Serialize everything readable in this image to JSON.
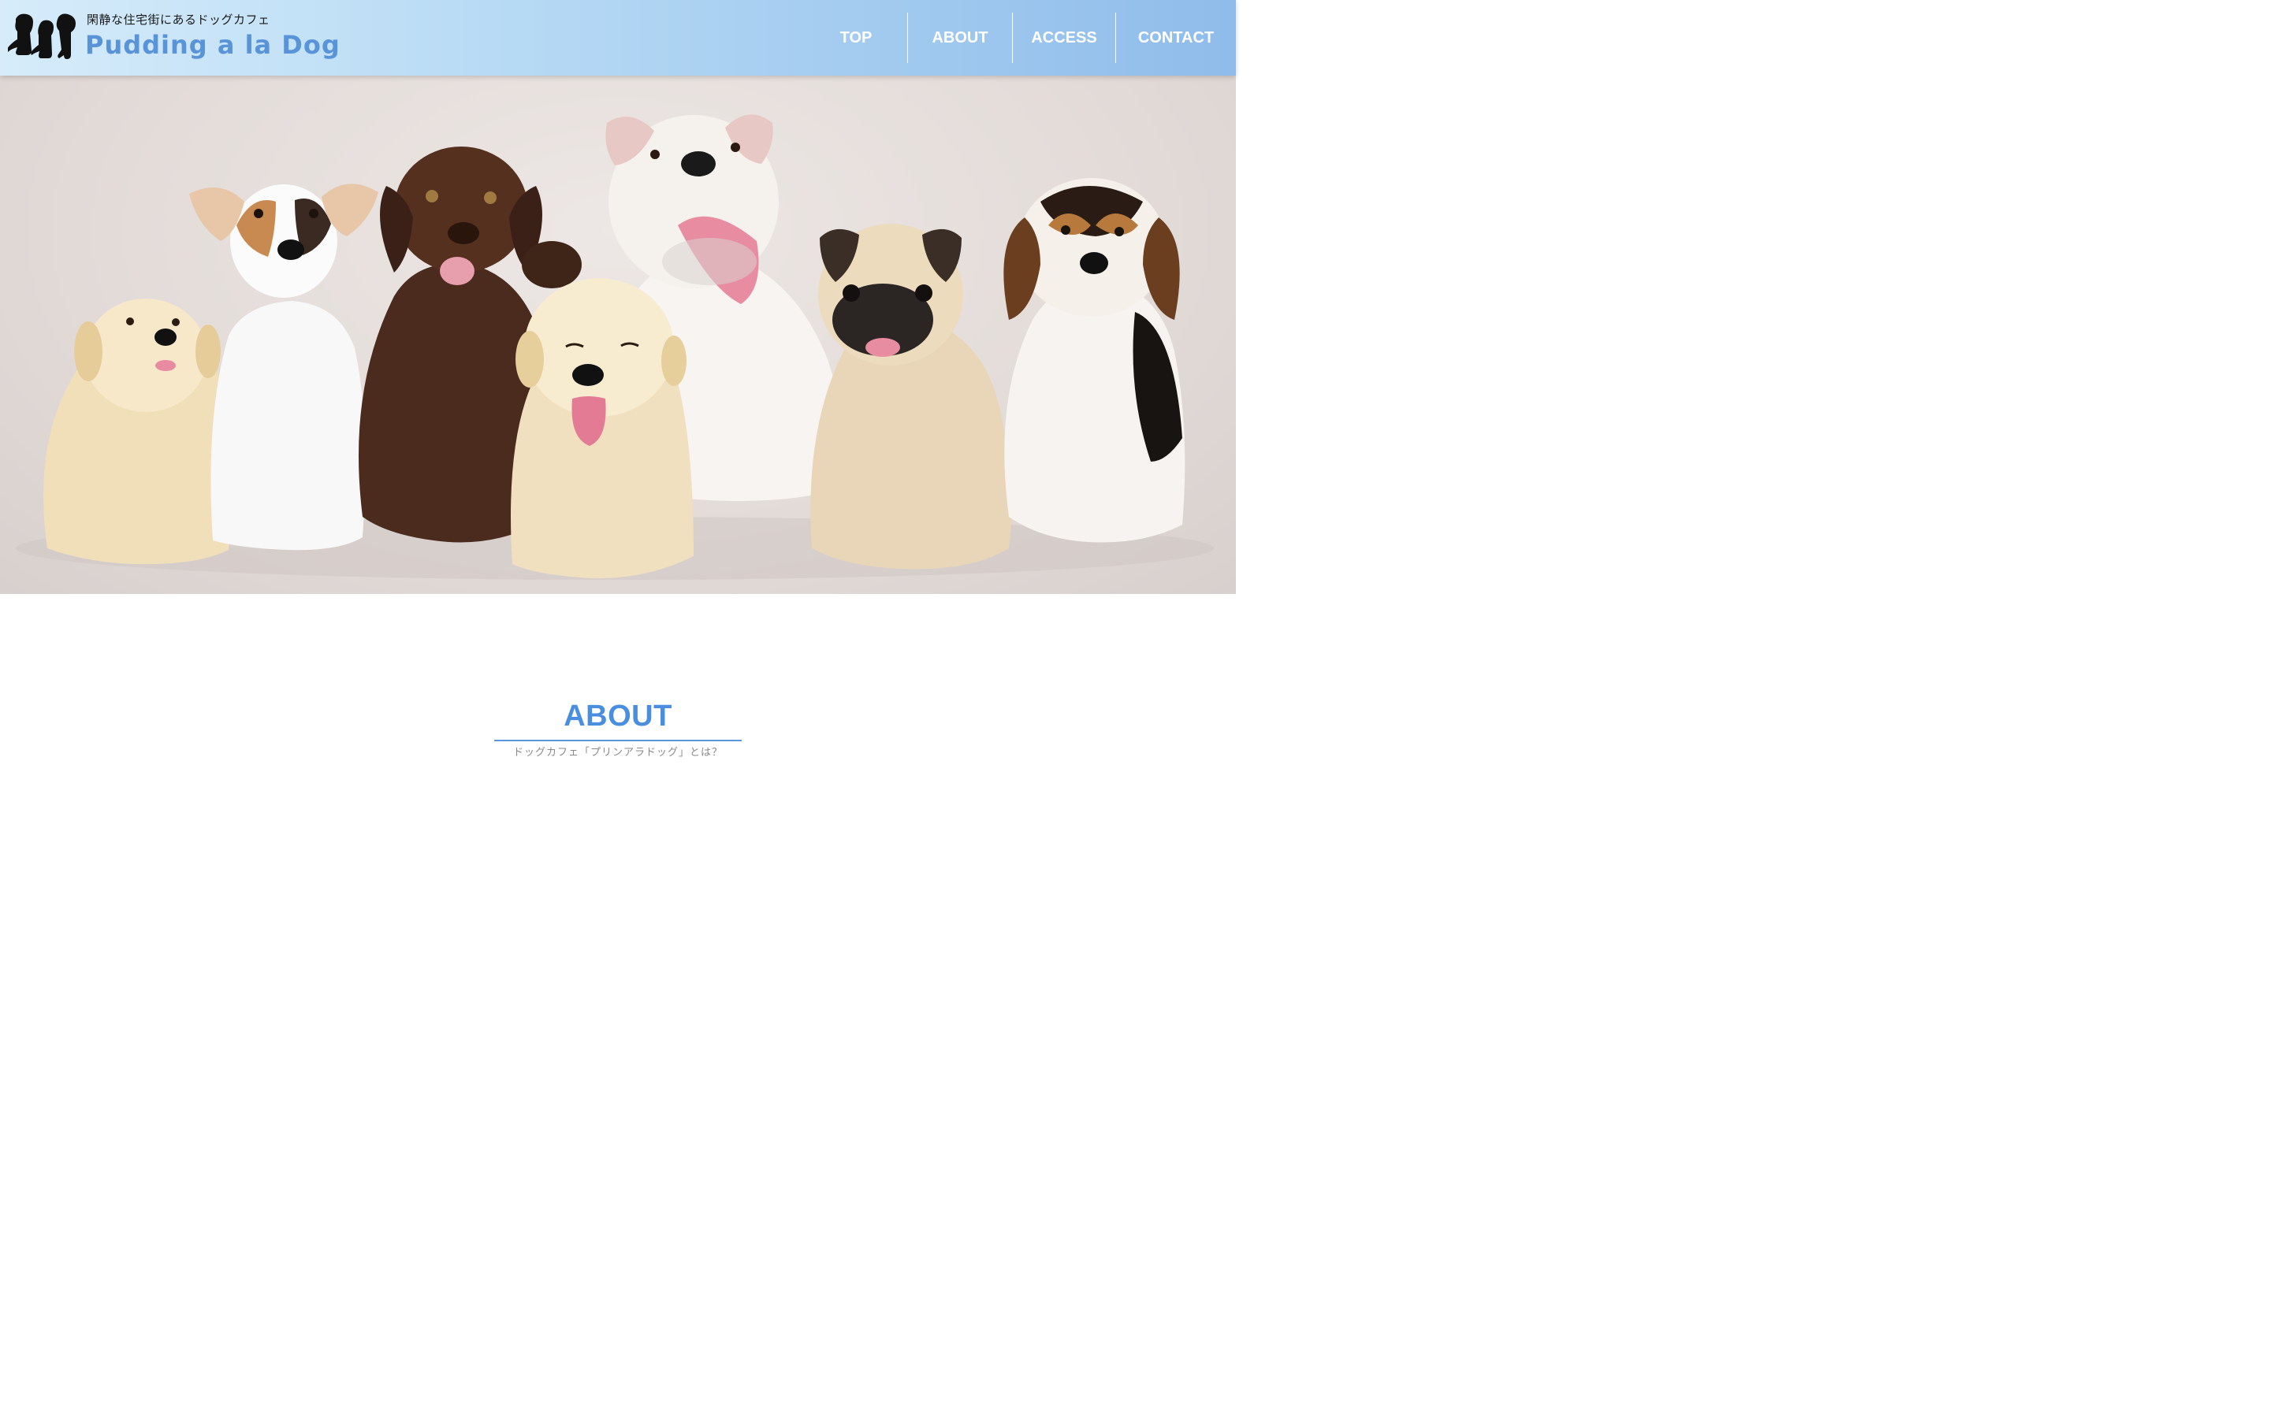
{
  "header": {
    "tagline": "閑静な住宅街にあるドッグカフェ",
    "brand": "Pudding a la Dog",
    "logo_icon": "three-dogs-silhouette-icon",
    "nav": [
      {
        "label": "TOP"
      },
      {
        "label": "ABOUT"
      },
      {
        "label": "ACCESS"
      },
      {
        "label": "CONTACT"
      }
    ]
  },
  "hero": {
    "image": "seven-puppies-photo"
  },
  "about": {
    "title": "ABOUT",
    "subtitle": "ドッグカフェ「プリンアラドッグ」とは？"
  },
  "colors": {
    "header_start": "#d6ecfa",
    "header_end": "#8fbcea",
    "brand": "#5a94d8",
    "accent": "#4a8ee0",
    "nav_text": "#ffffff"
  }
}
